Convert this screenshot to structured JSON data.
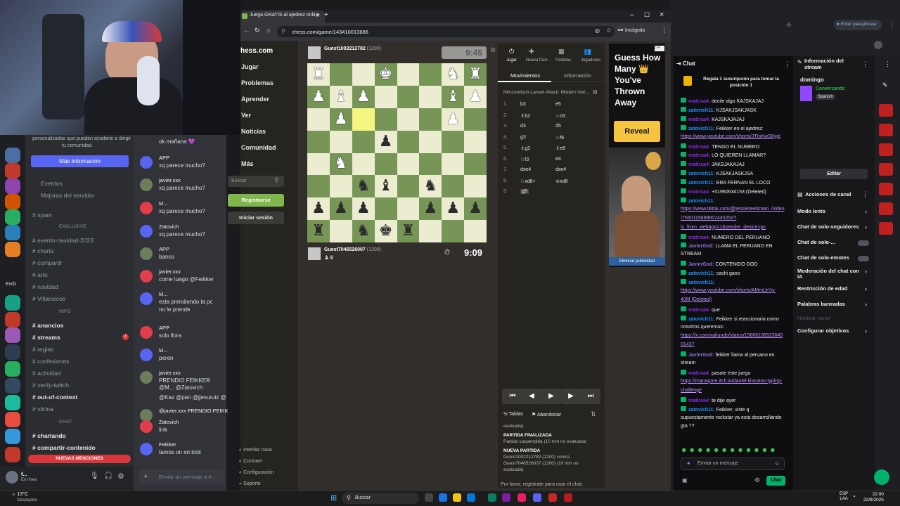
{
  "webcam": {
    "label": "webcam-overlay"
  },
  "discord": {
    "info_text_1": "personalizadas que pueden ayudarte a dirigir",
    "info_text_2": "tu comunidad.",
    "more_info_button": "Más información",
    "events": "Eventos",
    "server_improvements": "Mejoras del servidor",
    "channels": [
      {
        "name": "spam"
      },
      {
        "name": "EXCLUSIVE",
        "category": true
      },
      {
        "name": "evento-navidad-2023"
      },
      {
        "name": "charla"
      },
      {
        "name": "compartir"
      },
      {
        "name": "arte"
      },
      {
        "name": "navidad"
      },
      {
        "name": "Villansicos"
      },
      {
        "name": "INFO",
        "category": true
      },
      {
        "name": "anuncios",
        "bold": true
      },
      {
        "name": "streams",
        "bold": true,
        "badge": "1"
      },
      {
        "name": "reglas"
      },
      {
        "name": "confesiones"
      },
      {
        "name": "actividad"
      },
      {
        "name": "verify-twitch"
      },
      {
        "name": "out-of-context",
        "bold": true
      },
      {
        "name": "vitrina"
      },
      {
        "name": "CHAT",
        "category": true
      },
      {
        "name": "charlando",
        "bold": true
      },
      {
        "name": "compartir-contenido",
        "bold": true
      }
    ],
    "new_mentions": "NUEVAS MENCIONES",
    "user_name": "f...",
    "user_status": "En línea",
    "message_placeholder": "Enviar un mensaje a #...",
    "messages": [
      {
        "author": "",
        "text": "ok mañana 💜"
      },
      {
        "author": "APP",
        "text": "xq parece mucho?"
      },
      {
        "author": "javier.xxx",
        "text": "xq parece mucho?"
      },
      {
        "author": "M...",
        "text": "xq parece mucho?"
      },
      {
        "author": "Zatovich",
        "text": "xq parece mucho?"
      },
      {
        "author": "APP",
        "text": "banco"
      },
      {
        "author": "javier.xxx",
        "text": "come luego @Feikker"
      },
      {
        "author": "M...",
        "text": "esta prendiendo la pc"
      },
      {
        "author": "",
        "text": "no le prende"
      },
      {
        "author": "APP",
        "text": "solo llora"
      },
      {
        "author": "M...",
        "text": "peren"
      },
      {
        "author": "javier.xxx",
        "text": "PRENDIO FEIKKER"
      },
      {
        "author": "",
        "text": "@M... @Zatovich"
      },
      {
        "author": "",
        "text": "@Kaz @pan @jjesuruiz @"
      },
      {
        "author": "@javier.xxx PRENDIO FEIKK",
        "text": ""
      },
      {
        "author": "Zatovich",
        "text": "link"
      },
      {
        "author": "Feikker",
        "text": "tamos on en kick"
      }
    ]
  },
  "browser": {
    "tab_title": "Juega GRATIS al ajedrez online",
    "url": "chess.com/game/143410013886",
    "incognito": "Incógnito"
  },
  "chess": {
    "logo": "hess.com",
    "nav": [
      "Jugar",
      "Problemas",
      "Aprender",
      "Ver",
      "Noticias",
      "Comunidad",
      "Más"
    ],
    "search_placeholder": "Buscar",
    "register_button": "Registrarse",
    "login_button": "Iniciar sesión",
    "footer": [
      "Interfaz clara",
      "Contraer",
      "Configuración",
      "Soporte"
    ],
    "top_player": "Guest1002212782",
    "top_rating": "(1200)",
    "top_clock": "9:45",
    "bottom_player": "Guest7046526007",
    "bottom_rating": "(1200)",
    "bottom_clock": "9:09",
    "board": [
      [
        "wR",
        "",
        "",
        "wK",
        "",
        "",
        "wN",
        "wR"
      ],
      [
        "wP",
        "wB",
        "wP",
        "",
        "",
        "",
        "wB",
        "wP"
      ],
      [
        "",
        "wP",
        "",
        "",
        "",
        "",
        "wP",
        ""
      ],
      [
        "",
        "",
        "",
        "bP",
        "",
        "",
        "",
        ""
      ],
      [
        "",
        "wN",
        "",
        "",
        "",
        "",
        "",
        ""
      ],
      [
        "",
        "",
        "bN",
        "bB",
        "",
        "bN",
        "",
        ""
      ],
      [
        "bP",
        "bP",
        "bP",
        "",
        "",
        "bP",
        "bP",
        "bP"
      ],
      [
        "bR",
        "",
        "bN",
        "bK",
        "bR",
        "",
        "",
        ""
      ]
    ],
    "highlight": [
      [
        2,
        2
      ]
    ],
    "tabs_top": [
      "Jugar",
      "Nueva Part...",
      "Partidas",
      "Jugadores"
    ],
    "panel_tabs": [
      "Movimientos",
      "Información"
    ],
    "opening": "Nimzowitsch-Larsen Attack: Modern Vari...",
    "moves": [
      {
        "n": "1.",
        "w": "b3",
        "b": "e5"
      },
      {
        "n": "2.",
        "w": "♗b2",
        "b": "♘c6"
      },
      {
        "n": "3.",
        "w": "d3",
        "b": "d5"
      },
      {
        "n": "4.",
        "w": "g3",
        "b": "♘f6"
      },
      {
        "n": "5.",
        "w": "♗g2",
        "b": "♗e6"
      },
      {
        "n": "6.",
        "w": "♘f3",
        "b": "e4"
      },
      {
        "n": "7.",
        "w": "dxe4",
        "b": "dxe4"
      },
      {
        "n": "8.",
        "w": "♘xd8+",
        "b": "♔xd8"
      },
      {
        "n": "9.",
        "w": "g5",
        "b": ""
      }
    ],
    "controls_bar": [
      "Tablas",
      "Abandonar"
    ],
    "log": {
      "evaluada": "evaluada)",
      "finished": "PARTIDA FINALIZADA",
      "suspended": "Partida suspendida (10 min no evaluada)",
      "new_game": "NUEVA PARTIDA",
      "line1": "Guest1002212782 (1200) contra",
      "line2": "Guest7046526007 (1200) (10 min no",
      "line3": "evaluada)"
    },
    "register_note": "Por favor, registrate para usar el chat."
  },
  "ad": {
    "text": "Guess How Many 👑 You've Thrown Away",
    "button": "Reveal",
    "remove": "Eliminar publicidad"
  },
  "twitch": {
    "chat_title": "Chat",
    "promo": "Regala 1 suscripción para tomar la posición 1",
    "messages": [
      {
        "u": "matirsa4",
        "t": "decile algo KAJSKAJAJ"
      },
      {
        "u": "zatovich11",
        "t": "KJSAKJSAKJASK"
      },
      {
        "u": "matirsa4",
        "t": "KAJSKAJAJAJ"
      },
      {
        "u": "zatovich11",
        "t": "Feikker en el ajedrez:"
      },
      {
        "u": "",
        "t": "https://www.youtube.com/shorts/JTIoKwS8ygI"
      },
      {
        "u": "matirsa4",
        "t": "TENGO EL NUMERO"
      },
      {
        "u": "matirsa4",
        "t": "LO QUIEREN LLAMAR?"
      },
      {
        "u": "matirsa4",
        "t": "JAKSJAKAJAJ"
      },
      {
        "u": "zatovich11",
        "t": "KJSAKJASKJSA"
      },
      {
        "u": "zatovich11",
        "t": "ERA FERNAN EL LOCO"
      },
      {
        "u": "matirsa4",
        "t": "+51960634153 (Deleted)"
      },
      {
        "u": "zatovich11",
        "t": ""
      },
      {
        "u": "",
        "t": "https://www.tiktok.com/@jessiereelsman_/video"
      },
      {
        "u": "",
        "t": "/7550115889607445254?"
      },
      {
        "u": "",
        "t": "is_from_webapp=1&sender_device=pc"
      },
      {
        "u": "matirsa4",
        "t": "NUMERO DEL PERUANO"
      },
      {
        "u": "JavierGod",
        "t": "LLAMA EL PERUANO EN"
      },
      {
        "u": "",
        "t": "STREAM"
      },
      {
        "u": "JavierGod",
        "t": "CONTENIDO GOD"
      },
      {
        "u": "zatovich11",
        "t": "cachi gano"
      },
      {
        "u": "zatovich11",
        "t": ""
      },
      {
        "u": "",
        "t": "https://www.youtube.com/shorts/AMmUrYg-"
      },
      {
        "u": "",
        "t": "40M (Deleted)"
      },
      {
        "u": "matirsa4",
        "t": "que"
      },
      {
        "u": "zatovich11",
        "t": "Feikker si reaccionaria como"
      },
      {
        "u": "",
        "t": "nosotros queremos:"
      },
      {
        "u": "",
        "t": "https://x.com/xakundo/status/19666106923640"
      },
      {
        "u": "",
        "t": "01437"
      },
      {
        "u": "JavierGod",
        "t": "feikker llama al peruano en"
      },
      {
        "u": "",
        "t": "stream"
      },
      {
        "u": "matirsa4",
        "t": "pasate este juego"
      },
      {
        "u": "",
        "t": "https://managore.itch.io/daniel-linssens-typing-"
      },
      {
        "u": "",
        "t": "challenge"
      },
      {
        "u": "matirsa4",
        "t": "te dije ayer"
      },
      {
        "u": "zatovich11",
        "t": "Feikker, viste q"
      },
      {
        "u": "",
        "t": "supuestamente rockstar ya esta desarrollando"
      },
      {
        "u": "",
        "t": "gta 7?"
      }
    ],
    "input_placeholder": "Enviar un mensaje",
    "chat_button": "Chat",
    "stream_info_title": "Información del stream",
    "stream_title": "domingo",
    "category": "Conversando",
    "language": "Spanish",
    "edit_button": "Editar",
    "channel_actions": "Acciones de canal",
    "actions": [
      "Modo lento",
      "Chat de solo-seguidores",
      "Chat de solo-...",
      "Chat de solo-emotes",
      "Moderación del chat con IA",
      "Restricción de edad",
      "Palabras baneadas",
      "Hostear canal",
      "Configurar objetivos"
    ]
  },
  "chrome2": {
    "enter_passphrase": "Enter passphrase"
  },
  "taskbar": {
    "weather": "13°C",
    "weather_desc": "Despejado",
    "search": "Buscar",
    "lang": "ESP",
    "lang2": "LAA",
    "time": "22:00",
    "date": "22/9/2025"
  }
}
